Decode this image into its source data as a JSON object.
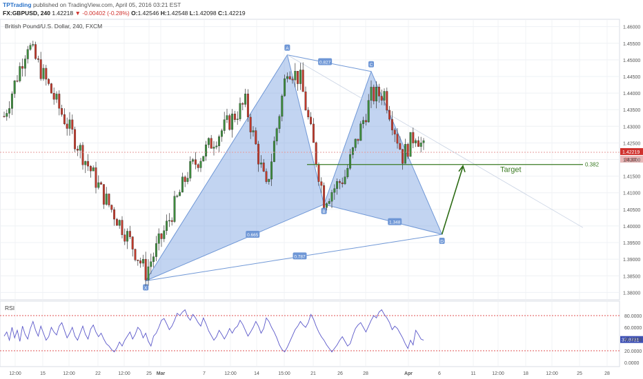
{
  "header": {
    "brand": "TPTrading",
    "published": "published on TradingView.com, April 05, 2016 03:21 EST",
    "symbol": "FX:GBPUSD, 240",
    "last": "1.42218",
    "change": "-0.00402 (-0.28%)",
    "o_label": "O:",
    "o": "1.42546",
    "h_label": "H:",
    "h": "1.42548",
    "l_label": "L:",
    "l": "1.42098",
    "c_label": "C:",
    "c": "1.42219"
  },
  "chart_data": [
    {
      "type": "candlestick",
      "title": "British Pound/U.S. Dollar, 240, FXCM",
      "ylim": [
        1.378,
        1.462
      ],
      "yticks": [
        "1.46000",
        "1.45500",
        "1.45000",
        "1.44500",
        "1.44000",
        "1.43500",
        "1.43000",
        "1.42500",
        "1.42000",
        "1.41500",
        "1.41000",
        "1.40500",
        "1.40000",
        "1.39500",
        "1.39000",
        "1.38500",
        "1.38000"
      ],
      "xticks": [
        "12:00",
        "15",
        "12:00",
        "22",
        "12:00",
        "25",
        "Mar",
        "7",
        "12:00",
        "14",
        "15:00",
        "21",
        "26",
        "28",
        "Apr",
        "6",
        "11",
        "12:00",
        "18",
        "12:00",
        "25",
        "28"
      ],
      "last_price_label": "1.42219",
      "countdown_label": "38:37",
      "key_points": [
        {
          "t": 0,
          "price": 1.433
        },
        {
          "t": 9,
          "price": 1.455
        },
        {
          "t": 20,
          "price": 1.437
        },
        {
          "t": 27,
          "price": 1.426
        },
        {
          "t": 38,
          "price": 1.409
        },
        {
          "t": 47,
          "price": 1.397
        },
        {
          "t": 54,
          "price": 1.386
        },
        {
          "t": 62,
          "price": 1.4
        },
        {
          "t": 70,
          "price": 1.416
        },
        {
          "t": 80,
          "price": 1.426
        },
        {
          "t": 92,
          "price": 1.437
        },
        {
          "t": 100,
          "price": 1.411
        },
        {
          "t": 108,
          "price": 1.448
        },
        {
          "t": 113,
          "price": 1.444
        },
        {
          "t": 122,
          "price": 1.408
        },
        {
          "t": 130,
          "price": 1.415
        },
        {
          "t": 140,
          "price": 1.439
        },
        {
          "t": 145,
          "price": 1.44
        },
        {
          "t": 152,
          "price": 1.421
        },
        {
          "t": 157,
          "price": 1.428
        },
        {
          "t": 160,
          "price": 1.423
        }
      ],
      "harmonic_pattern": {
        "points": [
          {
            "label": "X",
            "t": 54,
            "price": 1.3835
          },
          {
            "label": "A",
            "t": 108,
            "price": 1.4515
          },
          {
            "label": "B",
            "t": 122,
            "price": 1.4065
          },
          {
            "label": "C",
            "t": 140,
            "price": 1.4465
          },
          {
            "label": "D",
            "t": 167,
            "price": 1.3975
          }
        ],
        "ratios": [
          "0.665",
          "0.827",
          "0.787",
          "1.348"
        ]
      },
      "target": {
        "label": "Target",
        "level_label": "0.382",
        "price": 1.4185
      }
    },
    {
      "type": "line",
      "title": "RSI",
      "ylim": [
        0,
        100
      ],
      "yticks": [
        "80.0000",
        "60.0000",
        "40.0000",
        "20.0000",
        "0.0000"
      ],
      "bands": [
        80,
        20
      ],
      "last_value_label": "37.8731",
      "values": [
        45,
        52,
        38,
        60,
        42,
        55,
        36,
        62,
        48,
        40,
        58,
        70,
        55,
        45,
        62,
        50,
        38,
        44,
        60,
        52,
        47,
        62,
        68,
        55,
        42,
        50,
        60,
        45,
        38,
        50,
        62,
        48,
        40,
        57,
        64,
        52,
        44,
        50,
        40,
        32,
        28,
        22,
        18,
        25,
        35,
        28,
        38,
        45,
        52,
        40,
        48,
        60,
        55,
        42,
        50,
        36,
        28,
        45,
        50,
        60,
        72,
        75,
        66,
        56,
        62,
        72,
        84,
        80,
        86,
        90,
        78,
        72,
        82,
        76,
        68,
        62,
        76,
        66,
        54,
        46,
        38,
        44,
        55,
        48,
        40,
        48,
        58,
        50,
        58,
        62,
        72,
        65,
        55,
        45,
        52,
        60,
        70,
        62,
        50,
        58,
        76,
        70,
        60,
        52,
        42,
        30,
        22,
        18,
        26,
        36,
        46,
        56,
        62,
        70,
        64,
        60,
        68,
        82,
        74,
        62,
        52,
        44,
        38,
        30,
        24,
        18,
        24,
        30,
        38,
        44,
        36,
        28,
        32,
        46,
        58,
        64,
        68,
        60,
        52,
        62,
        72,
        80,
        76,
        86,
        90,
        82,
        76,
        68,
        56,
        62,
        58,
        50,
        42,
        32,
        24,
        38,
        30,
        55,
        48,
        40,
        38
      ]
    }
  ]
}
